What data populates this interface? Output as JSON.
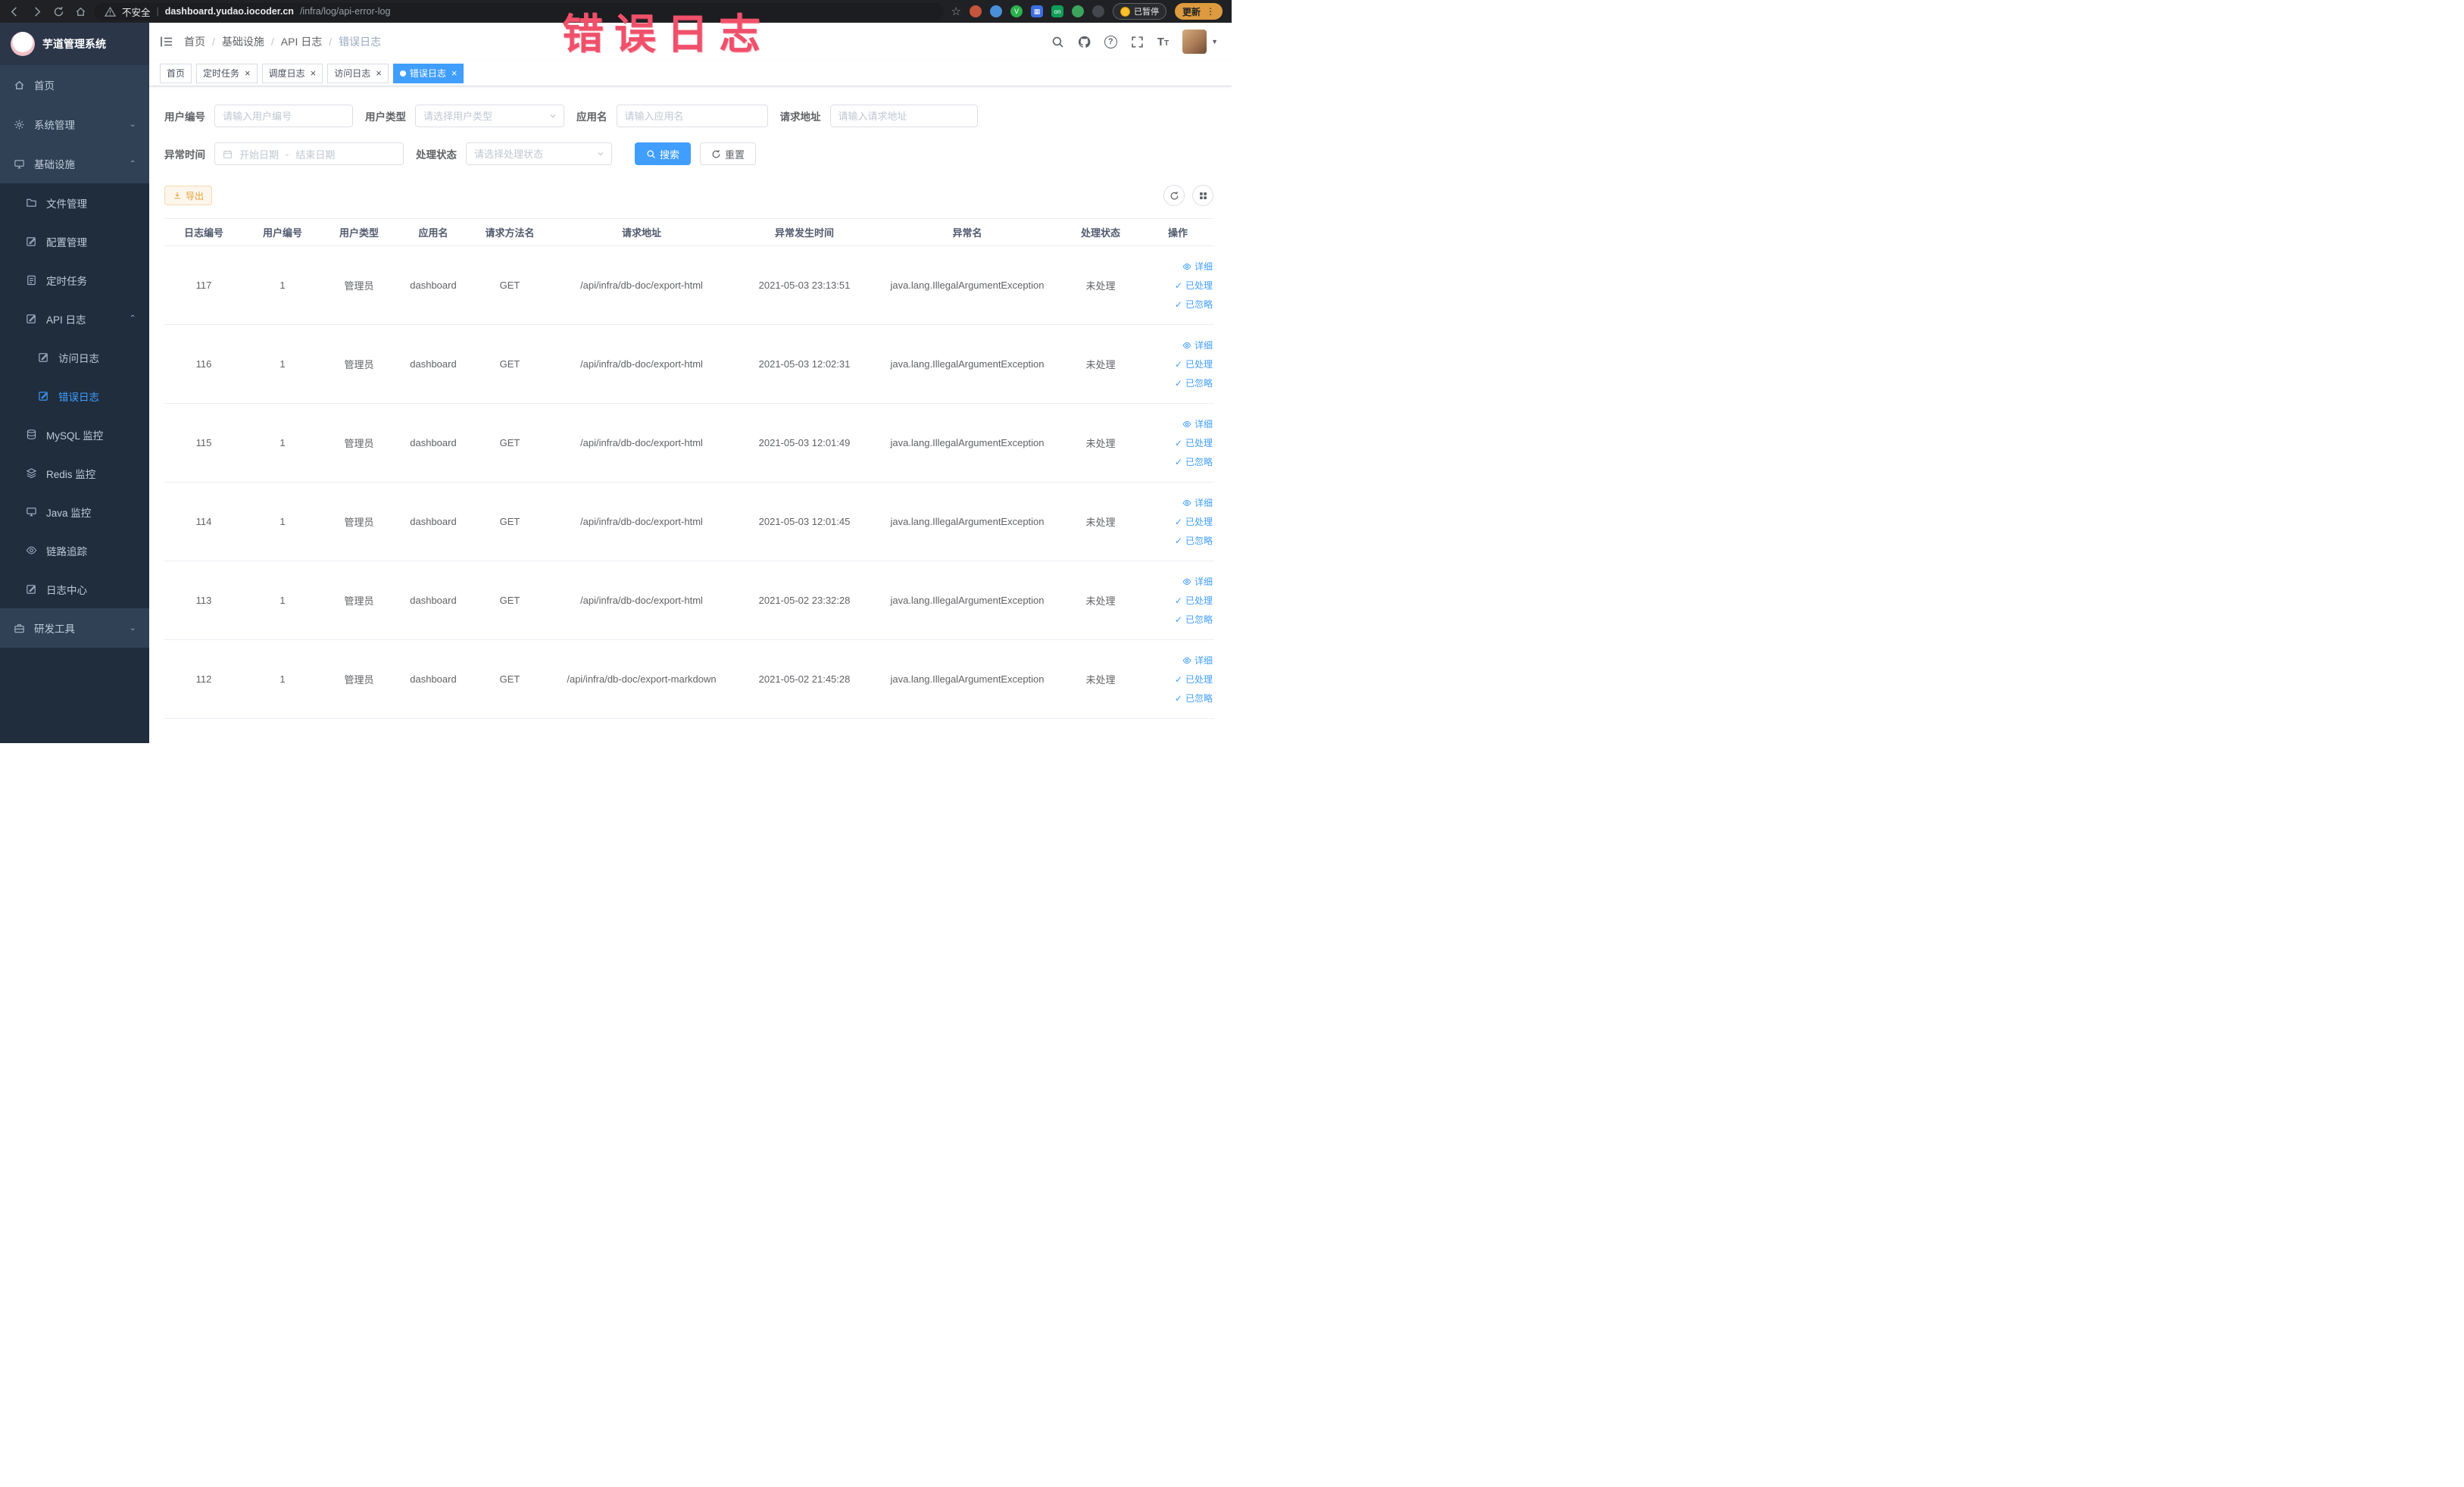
{
  "colors": {
    "primary": "#409eff",
    "warning": "#e6a23c",
    "annotation_red": "#f0506a",
    "sidebar_bg": "#304156",
    "submenu_bg": "#1f2d3d"
  },
  "browser": {
    "security_label": "不安全",
    "url_domain": "dashboard.yudao.iocoder.cn",
    "url_path": "/infra/log/api-error-log",
    "paused_badge": "已暂停",
    "update_button": "更新",
    "extension_on_badge": "on"
  },
  "annotation": {
    "text": "错误日志"
  },
  "sidebar": {
    "logo_title": "芋道管理系统",
    "home": "首页",
    "system": "系统管理",
    "infra": "基础设施",
    "file": "文件管理",
    "config": "配置管理",
    "job": "定时任务",
    "api_log": "API 日志",
    "access_log": "访问日志",
    "error_log": "错误日志",
    "mysql": "MySQL 监控",
    "redis": "Redis 监控",
    "java": "Java 监控",
    "trace": "链路追踪",
    "log_center": "日志中心",
    "dev_tools": "研发工具"
  },
  "header": {
    "breadcrumb": [
      {
        "label": "首页"
      },
      {
        "label": "基础设施"
      },
      {
        "label": "API 日志"
      },
      {
        "label": "错误日志"
      }
    ]
  },
  "tabs": [
    {
      "label": "首页",
      "closable": false,
      "active": false
    },
    {
      "label": "定时任务",
      "closable": true,
      "active": false
    },
    {
      "label": "调度日志",
      "closable": true,
      "active": false
    },
    {
      "label": "访问日志",
      "closable": true,
      "active": false
    },
    {
      "label": "错误日志",
      "closable": true,
      "active": true
    }
  ],
  "filters": {
    "user_id": {
      "label": "用户编号",
      "placeholder": "请输入用户编号"
    },
    "user_type": {
      "label": "用户类型",
      "placeholder": "请选择用户类型"
    },
    "app_name": {
      "label": "应用名",
      "placeholder": "请输入应用名"
    },
    "request_url": {
      "label": "请求地址",
      "placeholder": "请输入请求地址"
    },
    "exception_time": {
      "label": "异常时间",
      "start_placeholder": "开始日期",
      "separator": "-",
      "end_placeholder": "结束日期"
    },
    "process_status": {
      "label": "处理状态",
      "placeholder": "请选择处理状态"
    },
    "search_button": "搜索",
    "reset_button": "重置"
  },
  "toolbar": {
    "export_button": "导出"
  },
  "table": {
    "columns": [
      "日志编号",
      "用户编号",
      "用户类型",
      "应用名",
      "请求方法名",
      "请求地址",
      "异常发生时间",
      "异常名",
      "处理状态",
      "操作"
    ],
    "actions": [
      "详细",
      "已处理",
      "已忽略"
    ],
    "rows": [
      {
        "log_id": "117",
        "user_id": "1",
        "user_type": "管理员",
        "app_name": "dashboard",
        "method": "GET",
        "url": "/api/infra/db-doc/export-html",
        "time": "2021-05-03 23:13:51",
        "exception": "java.lang.IllegalArgumentException",
        "status": "未处理"
      },
      {
        "log_id": "116",
        "user_id": "1",
        "user_type": "管理员",
        "app_name": "dashboard",
        "method": "GET",
        "url": "/api/infra/db-doc/export-html",
        "time": "2021-05-03 12:02:31",
        "exception": "java.lang.IllegalArgumentException",
        "status": "未处理"
      },
      {
        "log_id": "115",
        "user_id": "1",
        "user_type": "管理员",
        "app_name": "dashboard",
        "method": "GET",
        "url": "/api/infra/db-doc/export-html",
        "time": "2021-05-03 12:01:49",
        "exception": "java.lang.IllegalArgumentException",
        "status": "未处理"
      },
      {
        "log_id": "114",
        "user_id": "1",
        "user_type": "管理员",
        "app_name": "dashboard",
        "method": "GET",
        "url": "/api/infra/db-doc/export-html",
        "time": "2021-05-03 12:01:45",
        "exception": "java.lang.IllegalArgumentException",
        "status": "未处理"
      },
      {
        "log_id": "113",
        "user_id": "1",
        "user_type": "管理员",
        "app_name": "dashboard",
        "method": "GET",
        "url": "/api/infra/db-doc/export-html",
        "time": "2021-05-02 23:32:28",
        "exception": "java.lang.IllegalArgumentException",
        "status": "未处理"
      },
      {
        "log_id": "112",
        "user_id": "1",
        "user_type": "管理员",
        "app_name": "dashboard",
        "method": "GET",
        "url": "/api/infra/db-doc/export-markdown",
        "time": "2021-05-02 21:45:28",
        "exception": "java.lang.IllegalArgumentException",
        "status": "未处理"
      }
    ]
  }
}
